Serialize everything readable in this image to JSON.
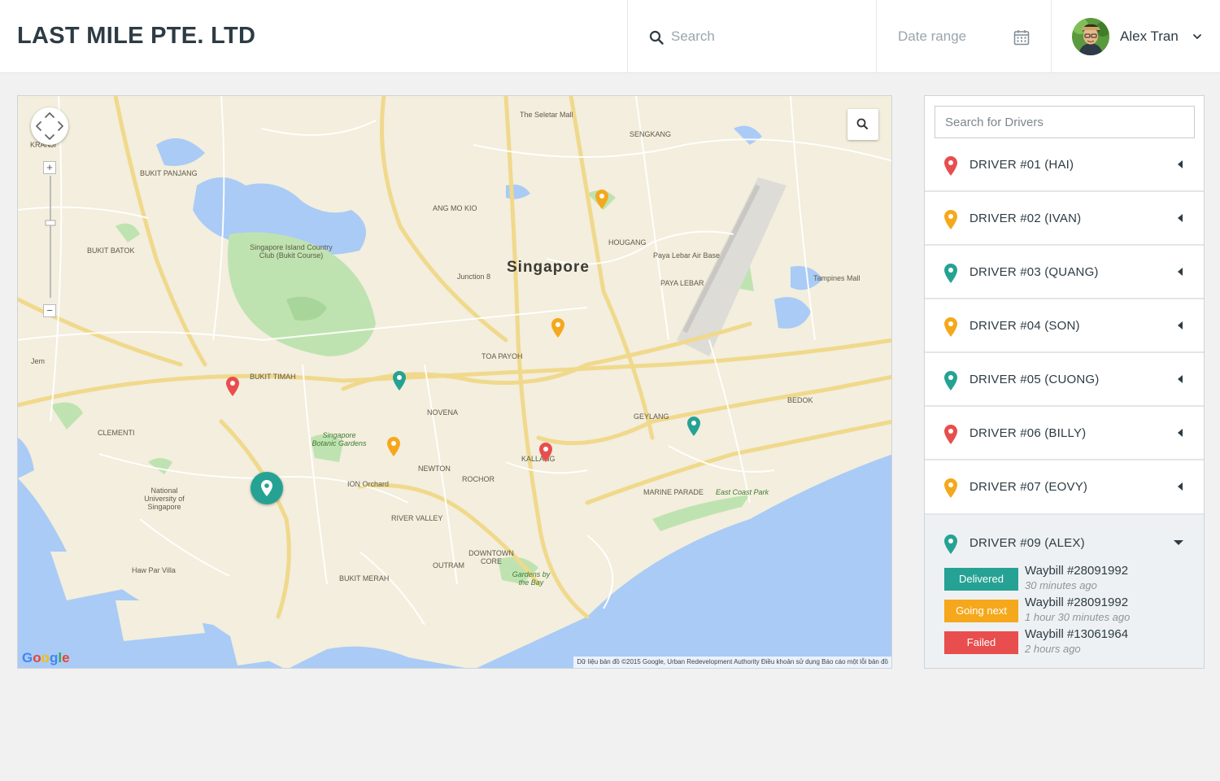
{
  "header": {
    "brand": "LAST MILE PTE. LTD",
    "search_placeholder": "Search",
    "date_range_placeholder": "Date range",
    "user_name": "Alex Tran"
  },
  "map": {
    "city_label": "Singapore",
    "google_logo": "Google",
    "attribution": "Dữ liệu bản đồ ©2015 Google, Urban Redevelopment Authority   Điều khoản sử dụng   Báo cáo một lỗi bản đồ",
    "places": [
      "The Seletar Mall",
      "SENGKANG",
      "ANG MO KIO",
      "HOUGANG",
      "Paya Lebar Air Base",
      "PAYA LEBAR",
      "Tampines Mall",
      "Junction 8",
      "TOA PAYOH",
      "BUKIT TIMAH",
      "NOVENA",
      "Singapore Botanic Gardens",
      "NEWTON",
      "ION Orchard",
      "KALLANG",
      "GEYLANG",
      "BEDOK",
      "MARINE PARADE",
      "East Coast Park",
      "ROCHOR",
      "RIVER VALLEY",
      "DOWNTOWN CORE",
      "Gardens by the Bay",
      "OUTRAM",
      "BUKIT MERAH",
      "Haw Par Villa",
      "National University of Singapore",
      "CLEMENTI",
      "BUKIT BATOK",
      "BUKIT PANJANG",
      "Singapore Island Country Club (Bukit Course)",
      "Jem",
      "KRANJI"
    ],
    "colors": {
      "land": "#f3eedd",
      "water": "#a9cbf6",
      "park": "#bfe3b0",
      "road": "#ffffff",
      "major_road": "#f0d98c"
    }
  },
  "markers": [
    {
      "color": "#f5a81c",
      "icon": "map-pin-icon"
    },
    {
      "color": "#f5a81c",
      "icon": "map-pin-icon"
    },
    {
      "color": "#e84e4e",
      "icon": "map-pin-icon"
    },
    {
      "color": "#26a294",
      "icon": "map-pin-icon"
    },
    {
      "color": "#f5a81c",
      "icon": "map-pin-icon"
    },
    {
      "color": "#e84e4e",
      "icon": "map-pin-icon"
    },
    {
      "color": "#26a294",
      "icon": "map-pin-icon"
    }
  ],
  "drivers_panel": {
    "search_placeholder": "Search for Drivers",
    "drivers": [
      {
        "label": "DRIVER #01 (HAI)",
        "color": "#e84e4e"
      },
      {
        "label": "DRIVER #02 (IVAN)",
        "color": "#f5a81c"
      },
      {
        "label": "DRIVER #03 (QUANG)",
        "color": "#26a294"
      },
      {
        "label": "DRIVER #04 (SON)",
        "color": "#f5a81c"
      },
      {
        "label": "DRIVER #05 (CUONG)",
        "color": "#26a294"
      },
      {
        "label": "DRIVER #06 (BILLY)",
        "color": "#e84e4e"
      },
      {
        "label": "DRIVER #07 (EOVY)",
        "color": "#f5a81c"
      }
    ],
    "expanded_driver": {
      "label": "DRIVER #09 (ALEX)",
      "color": "#26a294",
      "waybills": [
        {
          "status": "Delivered",
          "status_color": "#26a294",
          "title": "Waybill #28091992",
          "time": "30 minutes ago"
        },
        {
          "status": "Going next",
          "status_color": "#f5a81c",
          "title": "Waybill #28091992",
          "time": "1 hour 30 minutes ago"
        },
        {
          "status": "Failed",
          "status_color": "#e84e4e",
          "title": "Waybill #13061964",
          "time": "2 hours ago"
        }
      ]
    }
  }
}
